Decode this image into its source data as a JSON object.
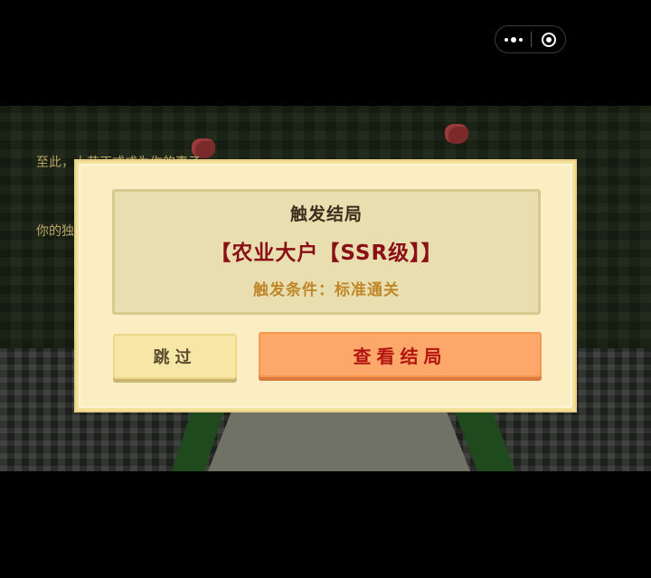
{
  "capsule": {
    "more_icon": "more-dots-icon",
    "close_icon": "record-close-icon"
  },
  "scene": {
    "story_line_1": "至此，大花正式成为你的妻子",
    "story_line_2": "你的独"
  },
  "dialog": {
    "title": "触发结局",
    "ending_name": "【农业大户【SSR级】】",
    "condition": "触发条件：标准通关",
    "skip_label": "跳过",
    "view_label": "查看结局"
  },
  "colors": {
    "dialog_bg": "#fbeec2",
    "panel_bg": "#e9deb0",
    "ending_red": "#8b0f16",
    "condition_gold": "#c0872a",
    "view_button": "#fda76a",
    "skip_button": "#f7e7a6"
  }
}
